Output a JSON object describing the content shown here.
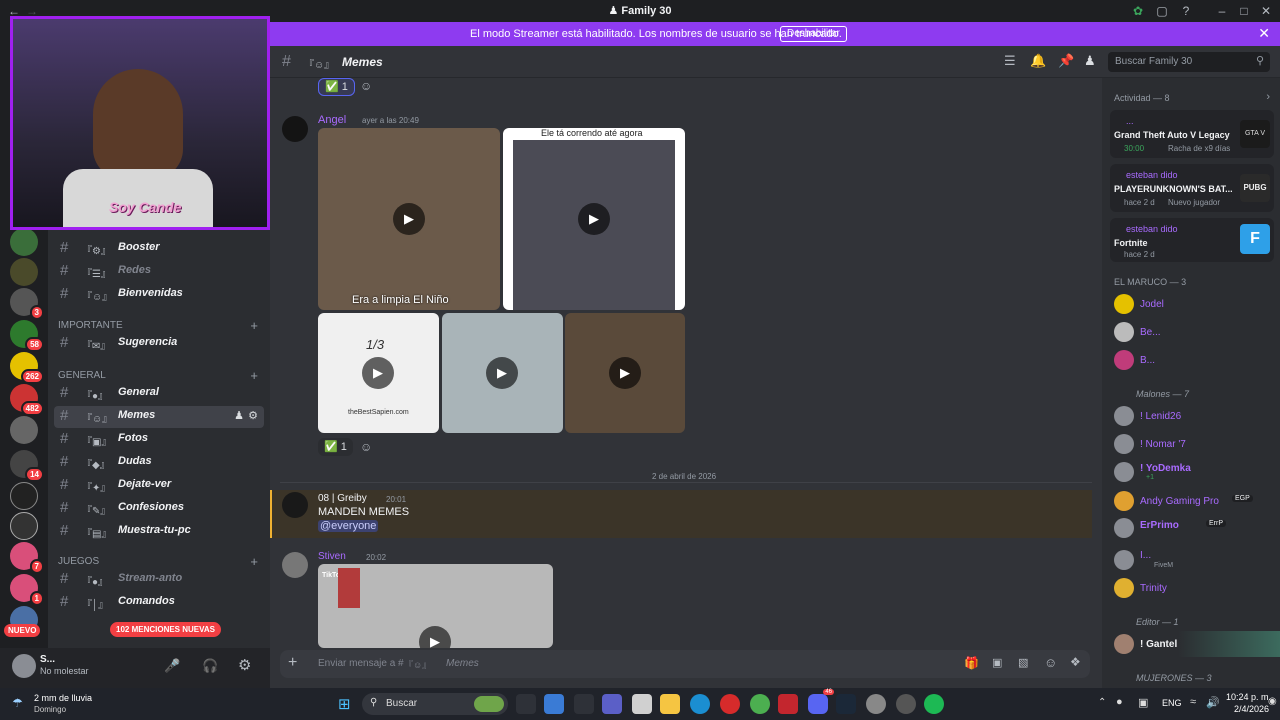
{
  "window": {
    "title": "Family 30",
    "server_icon": "♟"
  },
  "notice": {
    "text": "El modo Streamer está habilitado. Los nombres de usuario se han truncado.",
    "button": "Deshabilitar"
  },
  "guilds": {
    "badges": [
      "3",
      "58",
      "262",
      "482",
      "14",
      "7",
      "1"
    ],
    "new_label": "NUEVO",
    "mentions_label": "102 MENCIONES NUEVAS"
  },
  "channels": {
    "items": [
      {
        "emoji": "『⚙』",
        "label": "Booster",
        "muted": false
      },
      {
        "emoji": "『☰』",
        "label": "Redes",
        "muted": true
      },
      {
        "emoji": "『☺』",
        "label": "Bienvenidas",
        "muted": false
      }
    ],
    "cat_importante": "IMPORTANTE",
    "importante": [
      {
        "emoji": "『✉』",
        "label": "Sugerencia"
      }
    ],
    "cat_general": "GENERAL",
    "general": [
      {
        "emoji": "『●』",
        "label": "General"
      },
      {
        "emoji": "『☺』",
        "label": "Memes"
      },
      {
        "emoji": "『▣』",
        "label": "Fotos"
      },
      {
        "emoji": "『◆』",
        "label": "Dudas"
      },
      {
        "emoji": "『✦』",
        "label": "Dejate-ver"
      },
      {
        "emoji": "『✎』",
        "label": "Confesiones"
      },
      {
        "emoji": "『▤』",
        "label": "Muestra-tu-pc"
      }
    ],
    "cat_juegos": "JUEGOS",
    "juegos": [
      {
        "emoji": "『●』",
        "label": "Stream-anto",
        "muted": true
      },
      {
        "emoji": "『│』",
        "label": "Comandos",
        "muted": false
      }
    ]
  },
  "user": {
    "name": "S...",
    "status": "No molestar"
  },
  "header": {
    "emoji": "『☺』",
    "channel": "Memes",
    "search_placeholder": "Buscar Family 30"
  },
  "messages": {
    "reaction_top": {
      "emoji": "✅",
      "count": "1"
    },
    "angel": {
      "name": "Angel",
      "time": "ayer a las 20:49",
      "caption1": "Era a limpia El Niño",
      "caption2": "Ele tá correndo até agora",
      "tile3_text": "1/3",
      "tile3_sub": "theBestSapien.com"
    },
    "reaction_mid": {
      "emoji": "✅",
      "count": "1"
    },
    "date_divider": "2 de abril de 2026",
    "greiby": {
      "name": "08 | Greiby",
      "time": "20:01",
      "text": "MANDEN MEMES",
      "mention": "@everyone"
    },
    "stiven": {
      "name": "Stiven",
      "time": "20:02",
      "tiktok": "TikTok"
    }
  },
  "composer": {
    "placeholder_prefix": "Enviar mensaje a #",
    "emoji": "『☺』",
    "channel": "Memes"
  },
  "activity": {
    "header": "Actividad — 8",
    "cards": [
      {
        "user": "...",
        "game": "Grand Theft Auto V Legacy",
        "time": "30:00",
        "extra": "Racha de x9 días",
        "logo": "GTA V"
      },
      {
        "user": "esteban dido",
        "game": "PLAYERUNKNOWN'S BAT...",
        "time": "hace 2 d",
        "extra": "Nuevo jugador",
        "logo": "PUBG"
      },
      {
        "user": "esteban dido",
        "game": "Fortnite",
        "time": "hace 2 d",
        "extra": "",
        "logo": "F"
      }
    ]
  },
  "members": {
    "group1": "EL MARUCO — 3",
    "group1_items": [
      "Jodel",
      "Be...",
      "B..."
    ],
    "group2": "Malones — 7",
    "group2_items": [
      {
        "name": "! Lenid26",
        "sub": ""
      },
      {
        "name": "! Nomar '7",
        "sub": ""
      },
      {
        "name": "! YoDemka",
        "sub": "+1"
      },
      {
        "name": "Andy Gaming Pro",
        "sub": "",
        "tag": "EGP"
      },
      {
        "name": "ErPrimo",
        "sub": "",
        "tag": "ErrP"
      },
      {
        "name": "I...",
        "sub": "FiveM"
      },
      {
        "name": "Trinity",
        "sub": ""
      }
    ],
    "group3": "Editor — 1",
    "group3_items": [
      "! Gantel"
    ],
    "group4": "MUJERONES — 3"
  },
  "taskbar": {
    "weather": "2 mm de lluvia",
    "weather_sub": "Domingo",
    "search": "Buscar",
    "lang": "ENG",
    "time": "10:24 p. m.",
    "date": "2/4/2026",
    "discord_badge": "46"
  },
  "webcam": {
    "overlay_text": "Soy Cande"
  }
}
